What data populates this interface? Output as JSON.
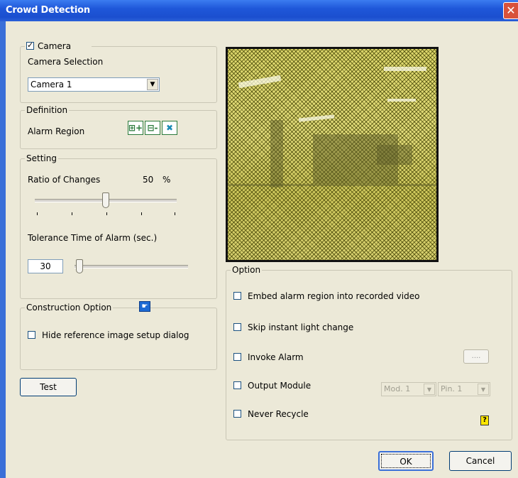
{
  "window": {
    "title": "Crowd Detection",
    "close_glyph": "✕"
  },
  "camera_group": {
    "checkbox_label": "Camera",
    "checked": true,
    "selection_label": "Camera Selection",
    "selected_camera": "Camera 1"
  },
  "definition": {
    "legend": "Definition",
    "alarm_region_label": "Alarm Region",
    "buttons": [
      {
        "glyph": "⊞+",
        "icon": "add-region-icon"
      },
      {
        "glyph": "⊟-",
        "icon": "remove-region-icon"
      },
      {
        "glyph": "✖",
        "icon": "clear-region-icon"
      }
    ]
  },
  "setting": {
    "legend": "Setting",
    "ratio_label": "Ratio of Changes",
    "ratio_value": "50",
    "ratio_unit": "%",
    "ratio_fraction": 0.5,
    "tolerance_label": "Tolerance Time of Alarm (sec.)",
    "tolerance_value": "30",
    "tolerance_fraction": 0.0
  },
  "construction": {
    "legend": "Construction Option",
    "icon": "hand-pointer-icon",
    "hide_reference_label": "Hide reference image setup dialog",
    "hide_reference_checked": false
  },
  "test_button": "Test",
  "option": {
    "legend": "Option",
    "embed_label": "Embed alarm region into recorded video",
    "skip_label": "Skip instant light change",
    "invoke_label": "Invoke Alarm",
    "invoke_button": "....",
    "output_label": "Output Module",
    "module_value": "Mod. 1",
    "pin_value": "Pin. 1",
    "never_recycle_label": "Never Recycle",
    "help_glyph": "?"
  },
  "footer": {
    "ok": "OK",
    "cancel": "Cancel"
  },
  "colors": {
    "title_bar": "#1f57d9",
    "dialog_bg": "#ece9d8",
    "region_overlay": "#dcd66a"
  }
}
